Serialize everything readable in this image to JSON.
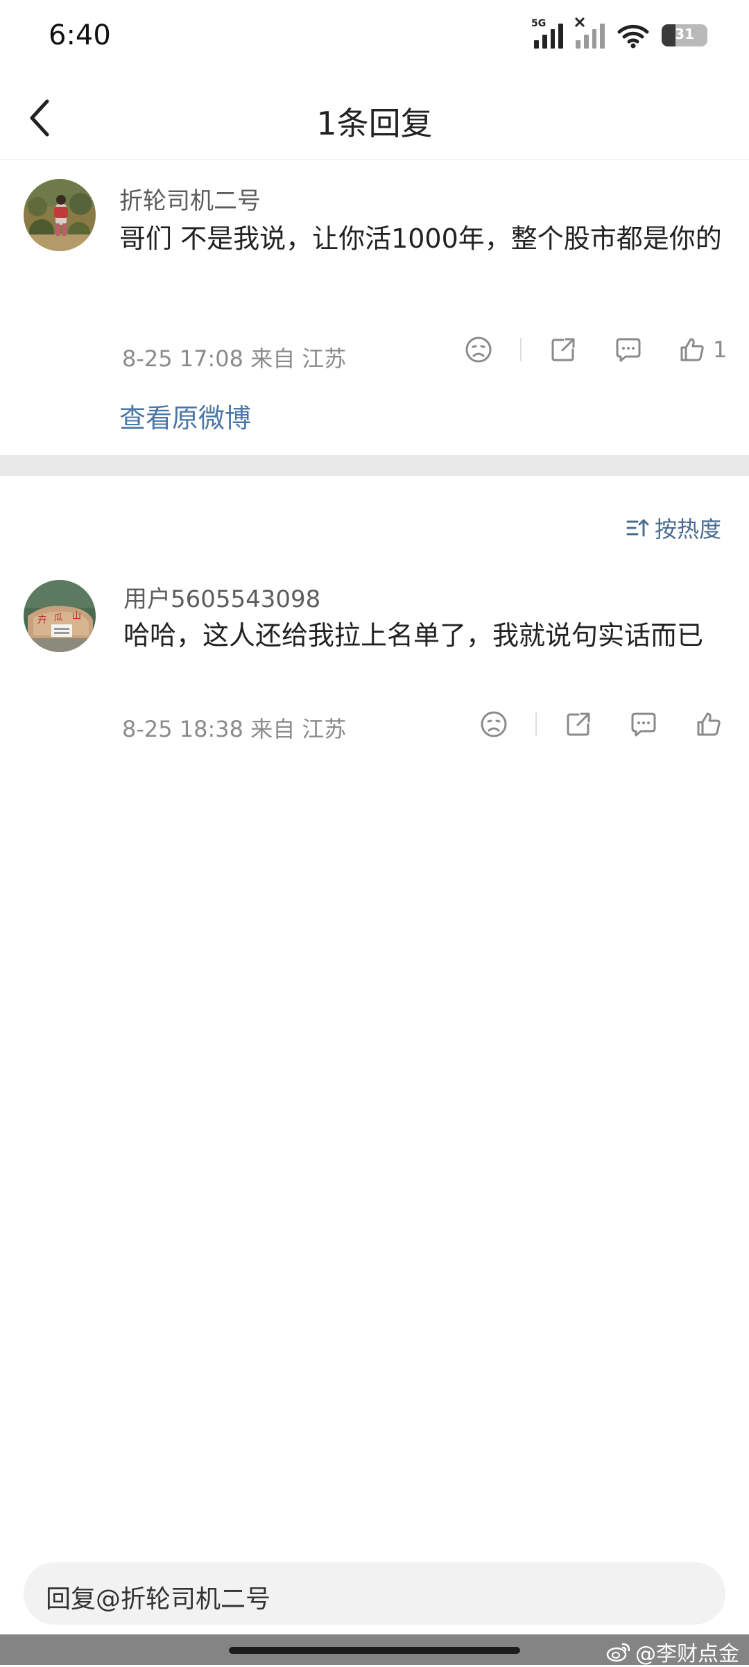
{
  "status_bar": {
    "time": "6:40",
    "network_tag": "5G",
    "battery_level": "31",
    "battery_fraction": 0.31
  },
  "header": {
    "title": "1条回复"
  },
  "root_comment": {
    "user_name": "折轮司机二号",
    "text": "哥们 不是我说，让你活1000年，整个股市都是你的",
    "meta": "8-25 17:08  来自 江苏",
    "like_count": "1",
    "view_original": "查看原微博"
  },
  "sort": {
    "label": "按热度"
  },
  "replies": [
    {
      "user_name": "用户5605543098",
      "text": "哈哈，这人还给我拉上名单了，我就说句实话而已",
      "meta": "8-25 18:38  来自 江苏"
    }
  ],
  "reply_input": {
    "placeholder": "回复@折轮司机二号"
  },
  "watermark": {
    "text": "@李财点金"
  },
  "colors": {
    "link": "#4a76a8",
    "sort": "#4a6b91",
    "meta": "#8b8b8b",
    "band": "#e9e9e9"
  }
}
